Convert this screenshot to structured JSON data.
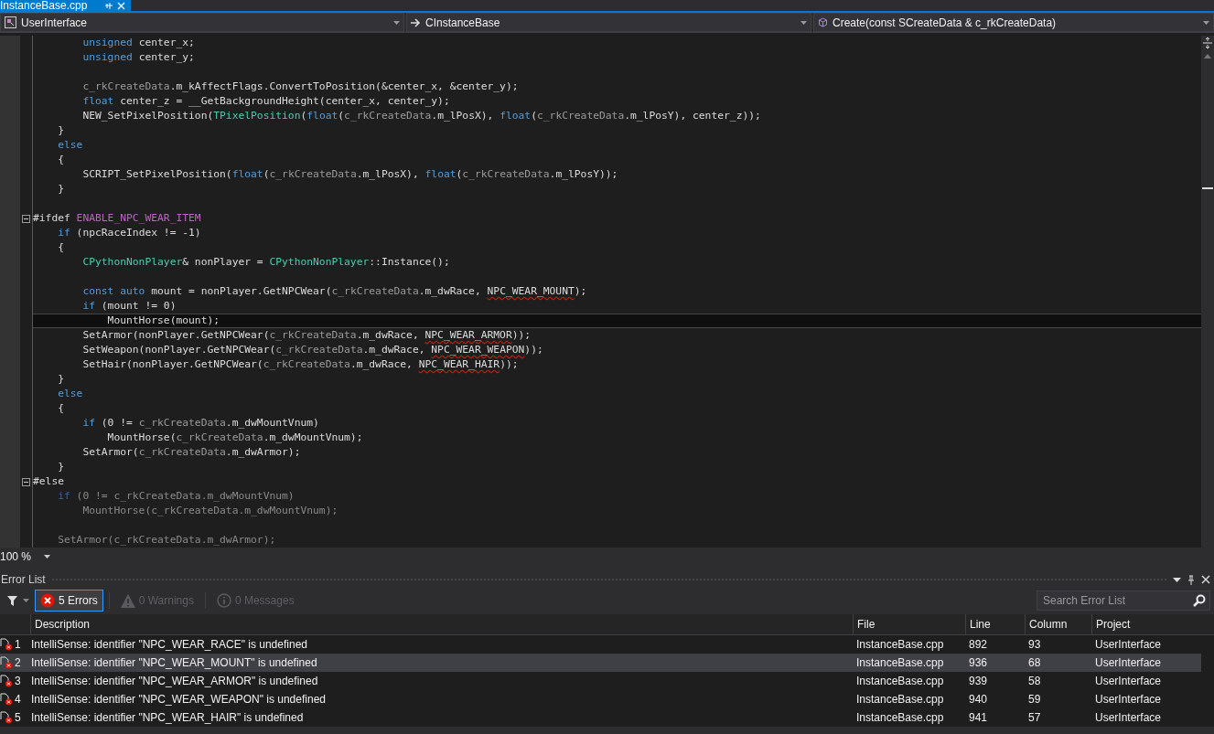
{
  "document_tab": {
    "title": "InstanceBase.cpp",
    "selected": true
  },
  "navigation": {
    "project": "UserInterface",
    "class": "CInstanceBase",
    "member": "Create(const SCreateData & c_rkCreateData)"
  },
  "code_lines": [
    {
      "kind": "code",
      "current": false,
      "inactive": false,
      "tokens": [
        {
          "kind": "kw",
          "text": "        unsigned"
        },
        {
          "kind": "plain",
          "text": " center_x;"
        }
      ]
    },
    {
      "kind": "code",
      "current": false,
      "inactive": false,
      "tokens": [
        {
          "kind": "kw",
          "text": "        unsigned"
        },
        {
          "kind": "plain",
          "text": " center_y;"
        }
      ]
    },
    {
      "kind": "blank"
    },
    {
      "kind": "code",
      "current": false,
      "inactive": false,
      "tokens": [
        {
          "kind": "param",
          "text": "        c_rkCreateData"
        },
        {
          "kind": "plain",
          "text": ".m_kAffectFlags.ConvertToPosition(&center_x, &center_y);"
        }
      ]
    },
    {
      "kind": "code",
      "current": false,
      "inactive": false,
      "tokens": [
        {
          "kind": "kw",
          "text": "        float"
        },
        {
          "kind": "plain",
          "text": " center_z = __GetBackgroundHeight(center_x, center_y);"
        }
      ]
    },
    {
      "kind": "code",
      "current": false,
      "inactive": false,
      "tokens": [
        {
          "kind": "plain",
          "text": "        NEW_SetPixelPosition("
        },
        {
          "kind": "type",
          "text": "TPixelPosition"
        },
        {
          "kind": "plain",
          "text": "("
        },
        {
          "kind": "kw",
          "text": "float"
        },
        {
          "kind": "plain",
          "text": "("
        },
        {
          "kind": "param",
          "text": "c_rkCreateData"
        },
        {
          "kind": "plain",
          "text": ".m_lPosX), "
        },
        {
          "kind": "kw",
          "text": "float"
        },
        {
          "kind": "plain",
          "text": "("
        },
        {
          "kind": "param",
          "text": "c_rkCreateData"
        },
        {
          "kind": "plain",
          "text": ".m_lPosY), center_z));"
        }
      ]
    },
    {
      "kind": "code",
      "current": false,
      "inactive": false,
      "tokens": [
        {
          "kind": "plain",
          "text": "    }"
        }
      ]
    },
    {
      "kind": "code",
      "current": false,
      "inactive": false,
      "tokens": [
        {
          "kind": "kw",
          "text": "    else"
        }
      ]
    },
    {
      "kind": "code",
      "current": false,
      "inactive": false,
      "tokens": [
        {
          "kind": "plain",
          "text": "    {"
        }
      ]
    },
    {
      "kind": "code",
      "current": false,
      "inactive": false,
      "tokens": [
        {
          "kind": "plain",
          "text": "        SCRIPT_SetPixelPosition("
        },
        {
          "kind": "kw",
          "text": "float"
        },
        {
          "kind": "plain",
          "text": "("
        },
        {
          "kind": "param",
          "text": "c_rkCreateData"
        },
        {
          "kind": "plain",
          "text": ".m_lPosX), "
        },
        {
          "kind": "kw",
          "text": "float"
        },
        {
          "kind": "plain",
          "text": "("
        },
        {
          "kind": "param",
          "text": "c_rkCreateData"
        },
        {
          "kind": "plain",
          "text": ".m_lPosY));"
        }
      ]
    },
    {
      "kind": "code",
      "current": false,
      "inactive": false,
      "tokens": [
        {
          "kind": "plain",
          "text": "    }"
        }
      ]
    },
    {
      "kind": "blank"
    },
    {
      "kind": "directive",
      "current": false,
      "inactive": false,
      "tokens": [
        {
          "kind": "plain",
          "text": "#ifdef "
        },
        {
          "kind": "macro",
          "text": "ENABLE_NPC_WEAR_ITEM"
        }
      ]
    },
    {
      "kind": "code",
      "current": false,
      "inactive": false,
      "tokens": [
        {
          "kind": "kw",
          "text": "    if"
        },
        {
          "kind": "plain",
          "text": " (npcRaceIndex != -1)"
        }
      ]
    },
    {
      "kind": "code",
      "current": false,
      "inactive": false,
      "tokens": [
        {
          "kind": "plain",
          "text": "    {"
        }
      ]
    },
    {
      "kind": "code",
      "current": false,
      "inactive": false,
      "tokens": [
        {
          "kind": "type",
          "text": "        CPythonNonPlayer"
        },
        {
          "kind": "plain",
          "text": "& nonPlayer = "
        },
        {
          "kind": "type",
          "text": "CPythonNonPlayer"
        },
        {
          "kind": "plain",
          "text": "::Instance();"
        }
      ]
    },
    {
      "kind": "blank"
    },
    {
      "kind": "code",
      "current": false,
      "inactive": false,
      "tokens": [
        {
          "kind": "kw",
          "text": "        const auto"
        },
        {
          "kind": "plain",
          "text": " mount = nonPlayer.GetNPCWear("
        },
        {
          "kind": "param",
          "text": "c_rkCreateData"
        },
        {
          "kind": "plain",
          "text": ".m_dwRace, "
        },
        {
          "kind": "error",
          "text": "NPC_WEAR_MOUNT"
        },
        {
          "kind": "plain",
          "text": ");"
        }
      ]
    },
    {
      "kind": "code",
      "current": false,
      "inactive": false,
      "tokens": [
        {
          "kind": "kw",
          "text": "        if"
        },
        {
          "kind": "plain",
          "text": " (mount != 0)"
        }
      ]
    },
    {
      "kind": "code",
      "current": true,
      "inactive": false,
      "tokens": [
        {
          "kind": "plain",
          "text": "            MountHorse(mount);"
        }
      ]
    },
    {
      "kind": "code",
      "current": false,
      "inactive": false,
      "tokens": [
        {
          "kind": "plain",
          "text": "        SetArmor(nonPlayer.GetNPCWear("
        },
        {
          "kind": "param",
          "text": "c_rkCreateData"
        },
        {
          "kind": "plain",
          "text": ".m_dwRace, "
        },
        {
          "kind": "error",
          "text": "NPC_WEAR_ARMOR"
        },
        {
          "kind": "plain",
          "text": "));"
        }
      ]
    },
    {
      "kind": "code",
      "current": false,
      "inactive": false,
      "tokens": [
        {
          "kind": "plain",
          "text": "        SetWeapon(nonPlayer.GetNPCWear("
        },
        {
          "kind": "param",
          "text": "c_rkCreateData"
        },
        {
          "kind": "plain",
          "text": ".m_dwRace, "
        },
        {
          "kind": "error",
          "text": "NPC_WEAR_WEAPON"
        },
        {
          "kind": "plain",
          "text": "));"
        }
      ]
    },
    {
      "kind": "code",
      "current": false,
      "inactive": false,
      "tokens": [
        {
          "kind": "plain",
          "text": "        SetHair(nonPlayer.GetNPCWear("
        },
        {
          "kind": "param",
          "text": "c_rkCreateData"
        },
        {
          "kind": "plain",
          "text": ".m_dwRace, "
        },
        {
          "kind": "error",
          "text": "NPC_WEAR_HAIR"
        },
        {
          "kind": "plain",
          "text": "));"
        }
      ]
    },
    {
      "kind": "code",
      "current": false,
      "inactive": false,
      "tokens": [
        {
          "kind": "plain",
          "text": "    }"
        }
      ]
    },
    {
      "kind": "code",
      "current": false,
      "inactive": false,
      "tokens": [
        {
          "kind": "kw",
          "text": "    else"
        }
      ]
    },
    {
      "kind": "code",
      "current": false,
      "inactive": false,
      "tokens": [
        {
          "kind": "plain",
          "text": "    {"
        }
      ]
    },
    {
      "kind": "code",
      "current": false,
      "inactive": false,
      "tokens": [
        {
          "kind": "kw",
          "text": "        if"
        },
        {
          "kind": "plain",
          "text": " (0 != "
        },
        {
          "kind": "param",
          "text": "c_rkCreateData"
        },
        {
          "kind": "plain",
          "text": ".m_dwMountVnum)"
        }
      ]
    },
    {
      "kind": "code",
      "current": false,
      "inactive": false,
      "tokens": [
        {
          "kind": "plain",
          "text": "            MountHorse("
        },
        {
          "kind": "param",
          "text": "c_rkCreateData"
        },
        {
          "kind": "plain",
          "text": ".m_dwMountVnum);"
        }
      ]
    },
    {
      "kind": "code",
      "current": false,
      "inactive": false,
      "tokens": [
        {
          "kind": "plain",
          "text": "        SetArmor("
        },
        {
          "kind": "param",
          "text": "c_rkCreateData"
        },
        {
          "kind": "plain",
          "text": ".m_dwArmor);"
        }
      ]
    },
    {
      "kind": "code",
      "current": false,
      "inactive": false,
      "tokens": [
        {
          "kind": "plain",
          "text": "    }"
        }
      ]
    },
    {
      "kind": "directive",
      "current": false,
      "inactive": false,
      "tokens": [
        {
          "kind": "plain",
          "text": "#else"
        }
      ]
    },
    {
      "kind": "code",
      "current": false,
      "inactive": true,
      "tokens": [
        {
          "kind": "kw",
          "text": "    if"
        },
        {
          "kind": "plain",
          "text": " (0 != c_rkCreateData.m_dwMountVnum)"
        }
      ]
    },
    {
      "kind": "code",
      "current": false,
      "inactive": true,
      "tokens": [
        {
          "kind": "plain",
          "text": "        MountHorse(c_rkCreateData.m_dwMountVnum);"
        }
      ]
    },
    {
      "kind": "blank"
    },
    {
      "kind": "code",
      "current": false,
      "inactive": true,
      "tokens": [
        {
          "kind": "plain",
          "text": "    SetArmor(c_rkCreateData.m_dwArmor);"
        }
      ]
    }
  ],
  "zoom": "100 %",
  "error_list": {
    "title": "Error List",
    "filters": [
      {
        "kind": "error",
        "label": "5 Errors",
        "selected": true
      },
      {
        "kind": "warning",
        "label": "0 Warnings",
        "selected": false
      },
      {
        "kind": "message",
        "label": "0 Messages",
        "selected": false
      }
    ],
    "search": {
      "placeholder": "Search Error List"
    },
    "columns": [
      "Description",
      "File",
      "Line",
      "Column",
      "Project"
    ],
    "rows": [
      {
        "number": "1",
        "description": "IntelliSense: identifier \"NPC_WEAR_RACE\" is undefined",
        "file": "InstanceBase.cpp",
        "line": "892",
        "column": "93",
        "project": "UserInterface",
        "selected": false
      },
      {
        "number": "2",
        "description": "IntelliSense: identifier \"NPC_WEAR_MOUNT\" is undefined",
        "file": "InstanceBase.cpp",
        "line": "936",
        "column": "68",
        "project": "UserInterface",
        "selected": true
      },
      {
        "number": "3",
        "description": "IntelliSense: identifier \"NPC_WEAR_ARMOR\" is undefined",
        "file": "InstanceBase.cpp",
        "line": "939",
        "column": "58",
        "project": "UserInterface",
        "selected": false
      },
      {
        "number": "4",
        "description": "IntelliSense: identifier \"NPC_WEAR_WEAPON\" is undefined",
        "file": "InstanceBase.cpp",
        "line": "940",
        "column": "59",
        "project": "UserInterface",
        "selected": false
      },
      {
        "number": "5",
        "description": "IntelliSense: identifier \"NPC_WEAR_HAIR\" is undefined",
        "file": "InstanceBase.cpp",
        "line": "941",
        "column": "57",
        "project": "UserInterface",
        "selected": false
      }
    ]
  }
}
